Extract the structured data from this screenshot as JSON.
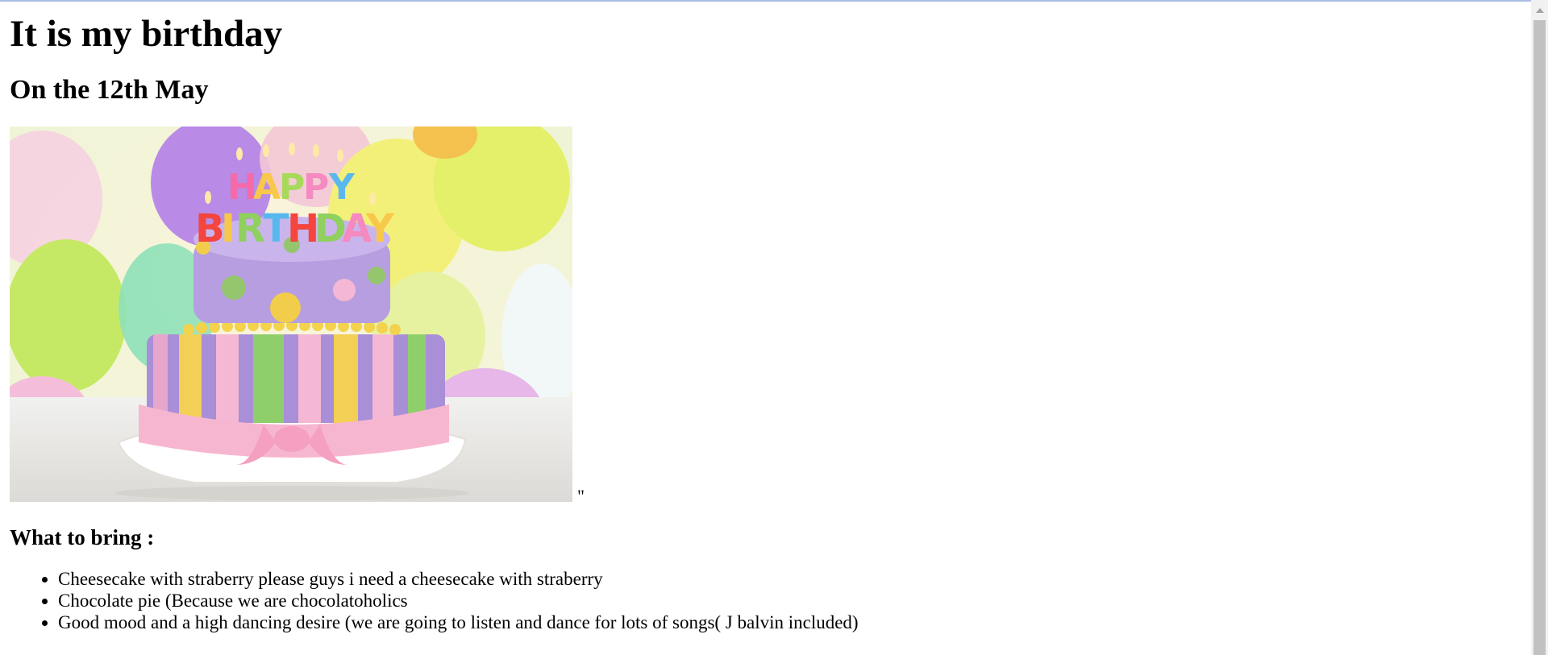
{
  "page": {
    "title": "It is my birthday",
    "subtitle": "On the 12th May",
    "trailing_text": "\"",
    "bring_heading": "What to bring :",
    "bring_items": [
      "Cheesecake with straberry please guys i need a cheesecake with straberry",
      "Chocolate pie (Because we are chocolatoholics",
      "Good mood and a high dancing desire (we are going to listen and dance for lots of songs( J balvin included)"
    ],
    "cake_candles_text": [
      "HAPPY",
      "BIRTHDAY"
    ]
  },
  "colors": {
    "scroll_track": "#f1f1f1",
    "scroll_thumb": "#c1c1c1",
    "top_border": "#a9bce6"
  }
}
